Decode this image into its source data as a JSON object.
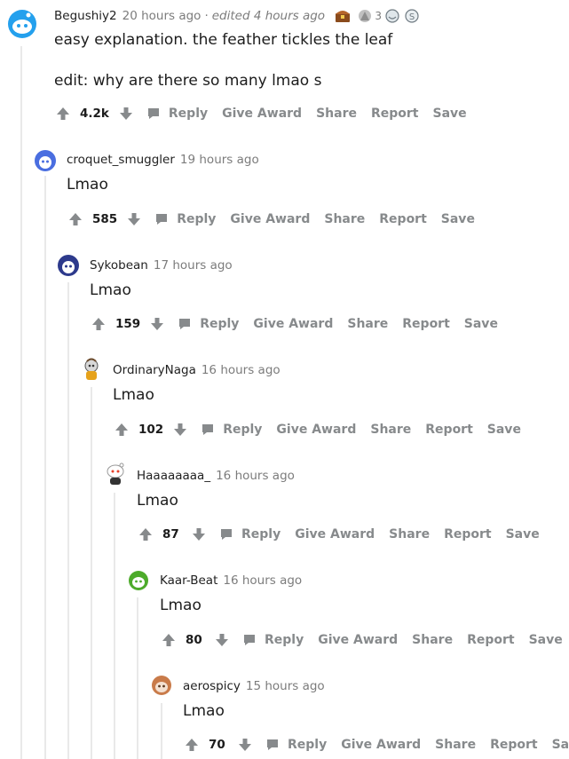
{
  "comments": [
    {
      "username": "Begushiy2",
      "time": "20 hours ago",
      "edited": "edited 4 hours ago",
      "award_count": "3",
      "body": "easy explanation. the feather tickles the leaf",
      "body_edit": "edit: why are there so many lmao s",
      "score": "4.2k",
      "reply": "Reply",
      "give_award": "Give Award",
      "share": "Share",
      "report": "Report",
      "save": "Save"
    },
    {
      "username": "croquet_smuggler",
      "time": "19 hours ago",
      "body": "Lmao",
      "score": "585",
      "reply": "Reply",
      "give_award": "Give Award",
      "share": "Share",
      "report": "Report",
      "save": "Save"
    },
    {
      "username": "Sykobean",
      "time": "17 hours ago",
      "body": "Lmao",
      "score": "159",
      "reply": "Reply",
      "give_award": "Give Award",
      "share": "Share",
      "report": "Report",
      "save": "Save"
    },
    {
      "username": "OrdinaryNaga",
      "time": "16 hours ago",
      "body": "Lmao",
      "score": "102",
      "reply": "Reply",
      "give_award": "Give Award",
      "share": "Share",
      "report": "Report",
      "save": "Save"
    },
    {
      "username": "Haaaaaaaa_",
      "time": "16 hours ago",
      "body": "Lmao",
      "score": "87",
      "reply": "Reply",
      "give_award": "Give Award",
      "share": "Share",
      "report": "Report",
      "save": "Save"
    },
    {
      "username": "Kaar-Beat",
      "time": "16 hours ago",
      "body": "Lmao",
      "score": "80",
      "reply": "Reply",
      "give_award": "Give Award",
      "share": "Share",
      "report": "Report",
      "save": "Save"
    },
    {
      "username": "aerospicy",
      "time": "15 hours ago",
      "body": "Lmao",
      "score": "70",
      "reply": "Reply",
      "give_award": "Give Award",
      "share": "Share",
      "report": "Report",
      "save": "Save"
    }
  ],
  "colors": {
    "text": "#1c1c1c",
    "meta": "#7c7c7c",
    "action": "#878a8c",
    "thread_line": "#e9e9e9",
    "background": "#ffffff"
  },
  "icons": {
    "upvote": "upvote-arrow-icon",
    "downvote": "downvote-arrow-icon",
    "reply": "speech-bubble-icon",
    "awards": [
      "treasure-chest-award-icon",
      "silver-award-icon",
      "wholesome-award-icon",
      "sad-award-icon"
    ]
  }
}
